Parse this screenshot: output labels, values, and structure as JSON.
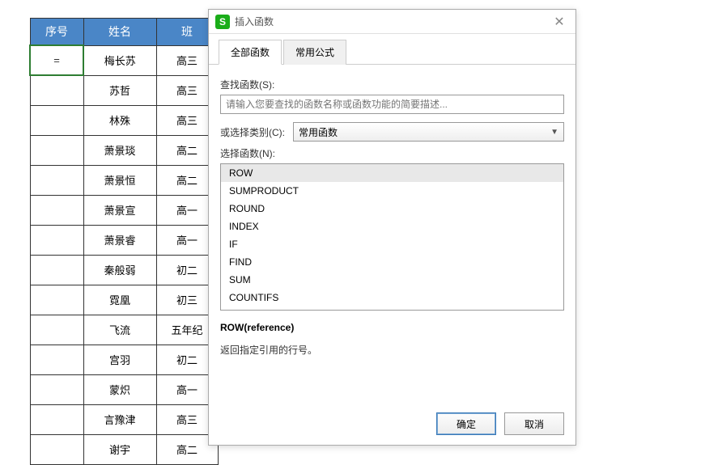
{
  "table": {
    "headers": [
      "序号",
      "姓名",
      "班"
    ],
    "formula_cell": "=",
    "rows": [
      {
        "name": "梅长苏",
        "class": "高三"
      },
      {
        "name": "苏哲",
        "class": "高三"
      },
      {
        "name": "林殊",
        "class": "高三"
      },
      {
        "name": "萧景琰",
        "class": "高二"
      },
      {
        "name": "萧景恒",
        "class": "高二"
      },
      {
        "name": "萧景宣",
        "class": "高一"
      },
      {
        "name": "萧景睿",
        "class": "高一"
      },
      {
        "name": "秦般弱",
        "class": "初二"
      },
      {
        "name": "霓凰",
        "class": "初三"
      },
      {
        "name": "飞流",
        "class": "五年纪"
      },
      {
        "name": "宫羽",
        "class": "初二"
      },
      {
        "name": "蒙炽",
        "class": "高一"
      },
      {
        "name": "言豫津",
        "class": "高三"
      },
      {
        "name": "谢宇",
        "class": "高二"
      }
    ]
  },
  "dialog": {
    "title": "插入函数",
    "close": "✕",
    "tabs": {
      "all": "全部函数",
      "common": "常用公式"
    },
    "search_label": "查找函数(S):",
    "search_placeholder": "请输入您要查找的函数名称或函数功能的简要描述...",
    "category_label": "或选择类别(C):",
    "category_value": "常用函数",
    "select_label": "选择函数(N):",
    "functions": [
      "ROW",
      "SUMPRODUCT",
      "ROUND",
      "INDEX",
      "IF",
      "FIND",
      "SUM",
      "COUNTIFS"
    ],
    "signature": "ROW(reference)",
    "description": "返回指定引用的行号。",
    "ok": "确定",
    "cancel": "取消"
  }
}
